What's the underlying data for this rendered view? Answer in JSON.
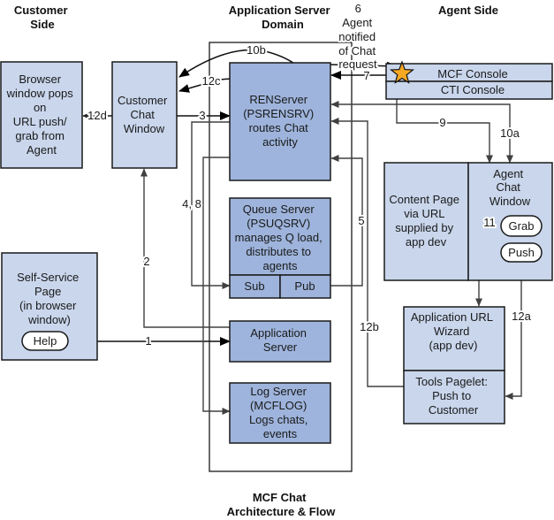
{
  "diagram": {
    "title": [
      "MCF Chat",
      "Architecture & Flow"
    ],
    "sections": {
      "customer_side": [
        "Customer",
        "Side"
      ],
      "app_server_domain": [
        "Application Server",
        "Domain"
      ],
      "agent_side": [
        "Agent Side"
      ]
    },
    "nodes": {
      "browser_window": [
        "Browser",
        "window pops",
        "on",
        "URL push/",
        "grab from",
        "Agent"
      ],
      "customer_chat_window": [
        "Customer",
        "Chat",
        "Window"
      ],
      "self_service_page": [
        "Self-Service",
        "Page",
        "(in browser",
        "window)"
      ],
      "help_button": "Help",
      "ren_server": [
        "RENServer",
        "(PSRENSRV)",
        "routes Chat",
        "activity"
      ],
      "queue_server": [
        "Queue Server",
        "(PSUQSRV)",
        "manages Q load,",
        "distributes to",
        "agents"
      ],
      "sub": "Sub",
      "pub": "Pub",
      "application_server": [
        "Application",
        "Server"
      ],
      "log_server": [
        "Log Server",
        "(MCFLOG)",
        "Logs chats,",
        "events"
      ],
      "mcf_console": "MCF Console",
      "cti_console": "CTI Console",
      "content_page": [
        "Content Page",
        "via URL",
        "supplied by",
        "app dev"
      ],
      "agent_chat_window": [
        "Agent",
        "Chat",
        "Window"
      ],
      "grab_button": "Grab",
      "push_button": "Push",
      "app_url_wizard": [
        "Application URL",
        "Wizard",
        "(app dev)"
      ],
      "tools_pagelet": [
        "Tools Pagelet:",
        "Push to",
        "Customer"
      ]
    },
    "flow_labels": {
      "f1": "1",
      "f2": "2",
      "f3": "3",
      "f4_8": "4, 8",
      "f5": "5",
      "f6": [
        "6",
        "Agent",
        "notified",
        "of Chat",
        "request"
      ],
      "f7": "7",
      "f9": "9",
      "f10a": "10a",
      "f10b": "10b",
      "f11": "11",
      "f12a": "12a",
      "f12b": "12b",
      "f12c": "12c",
      "f12d": "12d"
    },
    "icons": {
      "notification_star": "star-icon"
    }
  },
  "colors": {
    "box_light": "#C9D6EC",
    "box_dark": "#9EB4DC",
    "border": "#1A1A1A",
    "line": "#404040",
    "star": "#F7A823",
    "background": "#FFFFFF"
  }
}
